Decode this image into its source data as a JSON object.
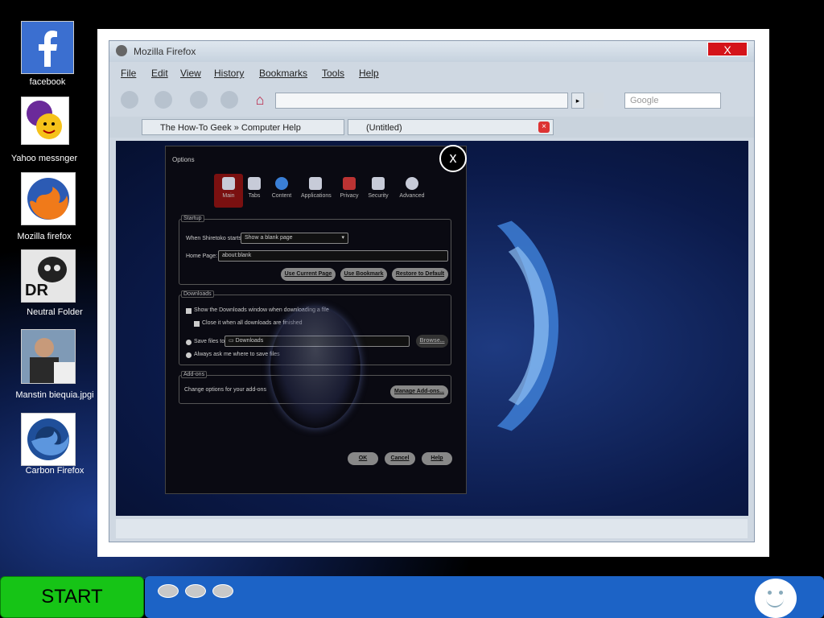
{
  "desktop": {
    "icons": [
      {
        "label": "facebook"
      },
      {
        "label": "Yahoo  messnger"
      },
      {
        "label": "Mozilla firefox"
      },
      {
        "label": "Neutral Folder"
      },
      {
        "label": "Manstin biequia.jpgi"
      },
      {
        "label": "Carbon Firefox"
      }
    ]
  },
  "browser": {
    "title": "Mozilla Firefox",
    "close_label": "X",
    "menu": [
      "File",
      "Edit",
      "View",
      "History",
      "Bookmarks",
      "Tools",
      "Help"
    ],
    "search_placeholder": "Google",
    "tabs": [
      "The How-To Geek » Computer Help",
      "(Untitled)"
    ]
  },
  "options_dialog": {
    "title": "Options",
    "close_label": "x",
    "tabs": [
      "Main",
      "Tabs",
      "Content",
      "Applications",
      "Privacy",
      "Security",
      "Advanced"
    ],
    "startup": {
      "group_label": "Startup",
      "when_label": "When Shiretoko starts:",
      "when_value": "Show a blank page",
      "home_label": "Home Page:",
      "home_value": "about:blank",
      "buttons": [
        "Use Current Page",
        "Use Bookmark",
        "Restore to Default"
      ]
    },
    "downloads": {
      "group_label": "Downloads",
      "show_window": "Show the Downloads window when downloading a file",
      "close_when_done": "Close it when all downloads are finished",
      "save_files_to": "Save files to",
      "save_folder": "Downloads",
      "browse": "Browse...",
      "always_ask": "Always ask me where to save files"
    },
    "addons": {
      "group_label": "Add-ons",
      "desc": "Change options for your add-ons",
      "manage": "Manage Add-ons..."
    },
    "footer_buttons": [
      "OK",
      "Cancel",
      "Help"
    ]
  },
  "taskbar": {
    "start_label": "START"
  },
  "colors": {
    "start_green": "#16c416",
    "taskbar_blue": "#1c63c6",
    "close_red": "#d4141a"
  }
}
